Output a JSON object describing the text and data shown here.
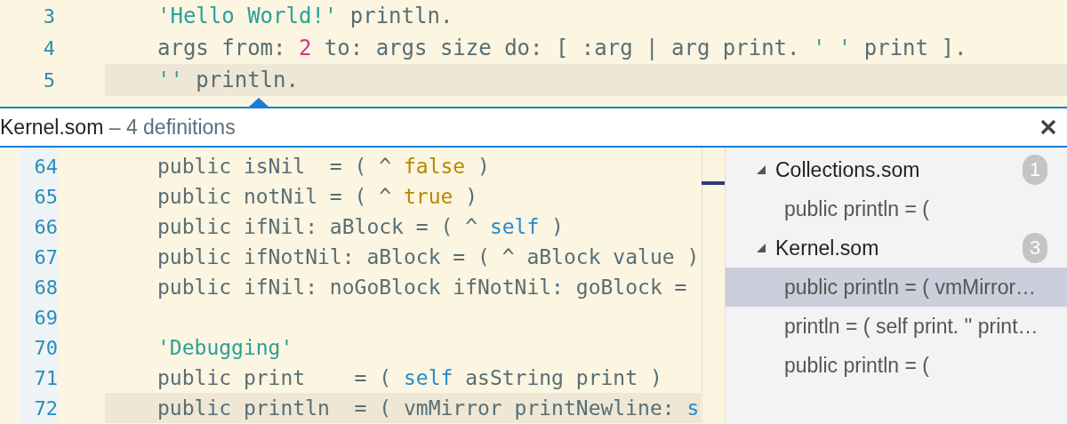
{
  "editor": {
    "lines": [
      {
        "number": "3",
        "current": false,
        "tokens": [
          {
            "text": "'Hello World!'",
            "kind": "string"
          },
          {
            "text": " println.",
            "kind": "plain"
          }
        ]
      },
      {
        "number": "4",
        "current": false,
        "tokens": [
          {
            "text": "args from: ",
            "kind": "plain"
          },
          {
            "text": "2",
            "kind": "number"
          },
          {
            "text": " to: args size do: [ :arg | arg print. ",
            "kind": "plain"
          },
          {
            "text": "' '",
            "kind": "string"
          },
          {
            "text": " print ].",
            "kind": "plain"
          }
        ]
      },
      {
        "number": "5",
        "current": true,
        "tokens": [
          {
            "text": "''",
            "kind": "string"
          },
          {
            "text": " println.",
            "kind": "plain"
          }
        ]
      }
    ]
  },
  "peek": {
    "file": "Kernel.som",
    "subtitle": "– 4 definitions",
    "lines": [
      {
        "number": "64",
        "current": false,
        "tokens": [
          {
            "text": "public isNil  = ( ^ ",
            "kind": "plain"
          },
          {
            "text": "false",
            "kind": "literal"
          },
          {
            "text": " )",
            "kind": "plain"
          }
        ]
      },
      {
        "number": "65",
        "current": false,
        "tokens": [
          {
            "text": "public notNil = ( ^ ",
            "kind": "plain"
          },
          {
            "text": "true",
            "kind": "literal"
          },
          {
            "text": " )",
            "kind": "plain"
          }
        ]
      },
      {
        "number": "66",
        "current": false,
        "tokens": [
          {
            "text": "public ifNil: aBlock = ( ^ ",
            "kind": "plain"
          },
          {
            "text": "self",
            "kind": "keyword"
          },
          {
            "text": " )",
            "kind": "plain"
          }
        ]
      },
      {
        "number": "67",
        "current": false,
        "tokens": [
          {
            "text": "public ifNotNil: aBlock = ( ^ aBlock value )",
            "kind": "plain"
          }
        ]
      },
      {
        "number": "68",
        "current": false,
        "tokens": [
          {
            "text": "public ifNil: noGoBlock ifNotNil: goBlock =",
            "kind": "plain"
          }
        ]
      },
      {
        "number": "69",
        "current": false
      },
      {
        "number": "70",
        "current": false,
        "tokens": [
          {
            "text": "'Debugging'",
            "kind": "string"
          }
        ]
      },
      {
        "number": "71",
        "current": false,
        "tokens": [
          {
            "text": "public print    = ( ",
            "kind": "plain"
          },
          {
            "text": "self",
            "kind": "keyword"
          },
          {
            "text": " asString print )",
            "kind": "plain"
          }
        ]
      },
      {
        "number": "72",
        "current": true,
        "tokens": [
          {
            "text": "public println  = ( vmMirror printNewline: ",
            "kind": "plain"
          },
          {
            "text": "s",
            "kind": "keyword"
          }
        ]
      }
    ],
    "references": [
      {
        "file": "Collections.som",
        "count": "1",
        "expanded": true,
        "children": [
          {
            "text": "public println = (",
            "selected": false
          }
        ]
      },
      {
        "file": "Kernel.som",
        "count": "3",
        "expanded": true,
        "children": [
          {
            "text": "public println = ( vmMirror…",
            "selected": true
          },
          {
            "text": "println = ( self print. '' print…",
            "selected": false
          },
          {
            "text": "public println = (",
            "selected": false
          }
        ]
      }
    ]
  }
}
